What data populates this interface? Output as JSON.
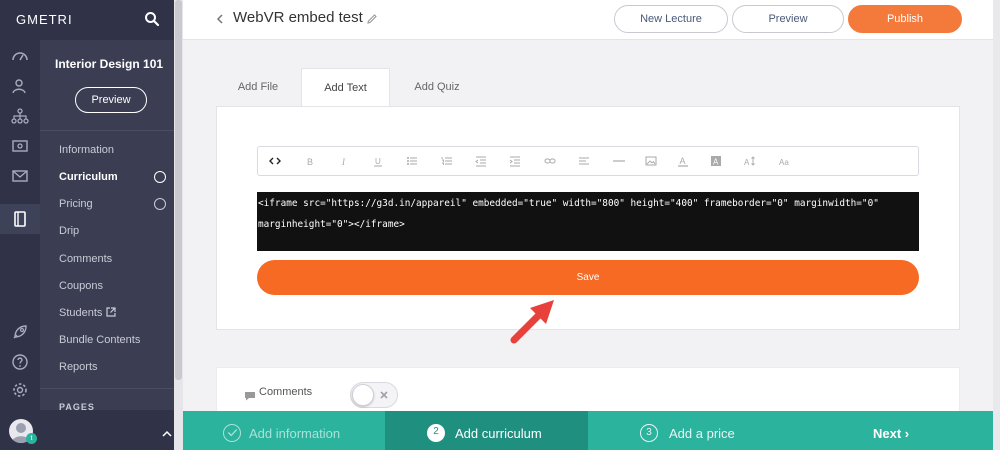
{
  "app": {
    "brand": "GMETRI"
  },
  "rail": {
    "icons": [
      "dashboard-icon",
      "users-icon",
      "network-icon",
      "dollar-icon",
      "mail-icon",
      "book-icon",
      "rocket-icon",
      "help-icon",
      "settings-icon"
    ]
  },
  "course": {
    "title": "Interior Design 101",
    "preview_label": "Preview",
    "nav": [
      {
        "label": "Information"
      },
      {
        "label": "Curriculum"
      },
      {
        "label": "Pricing"
      },
      {
        "label": "Drip"
      },
      {
        "label": "Comments"
      },
      {
        "label": "Coupons"
      },
      {
        "label": "Students"
      },
      {
        "label": "Bundle Contents"
      },
      {
        "label": "Reports"
      }
    ],
    "pages_label": "PAGES"
  },
  "user": {
    "badge": "t"
  },
  "header": {
    "title": "WebVR embed test",
    "new_lecture_label": "New Lecture",
    "preview_label": "Preview",
    "publish_label": "Publish"
  },
  "tabs": [
    {
      "label": "Add File"
    },
    {
      "label": "Add Text"
    },
    {
      "label": "Add Quiz"
    }
  ],
  "editor": {
    "code_line1": "<iframe src=\"https://g3d.in/appareil\" embedded=\"true\" width=\"800\" height=\"400\" frameborder=\"0\" marginwidth=\"0\"",
    "code_line2": "marginheight=\"0\"></iframe>",
    "toolbar": [
      "code-icon",
      "bold-icon",
      "italic-icon",
      "underline-icon",
      "bullet-list-icon",
      "numbered-list-icon",
      "outdent-icon",
      "indent-icon",
      "link-icon",
      "align-icon",
      "horizontal-rule-icon",
      "image-icon",
      "text-color-icon",
      "background-color-icon",
      "font-size-icon",
      "font-style-icon"
    ],
    "save_label": "Save"
  },
  "comments": {
    "label": "Comments"
  },
  "wizard": {
    "steps": [
      {
        "number": "",
        "label": "Add information"
      },
      {
        "number": "2",
        "label": "Add curriculum"
      },
      {
        "number": "3",
        "label": "Add a price"
      }
    ],
    "next_label": "Next ›"
  },
  "colors": {
    "accent": "#f47a3c",
    "save": "#f66a24",
    "sidebar": "#303347",
    "panel": "#3b3e52",
    "wizard": "#2bb39e",
    "wizard_active": "#1f8f80"
  }
}
